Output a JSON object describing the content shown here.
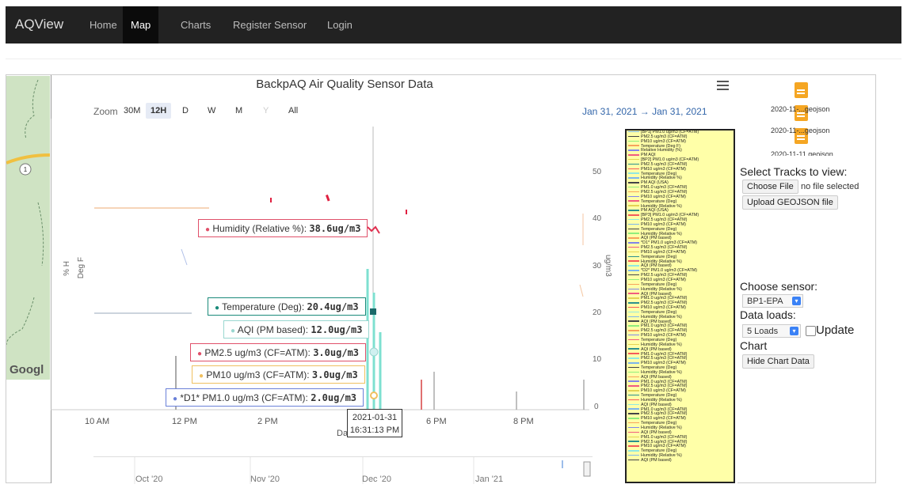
{
  "nav": {
    "brand": "AQView",
    "items": [
      {
        "label": "Home",
        "active": false
      },
      {
        "label": "Map",
        "active": true
      },
      {
        "label": "Charts",
        "active": false
      },
      {
        "label": "Register Sensor",
        "active": false
      },
      {
        "label": "Login",
        "active": false
      }
    ]
  },
  "map": {
    "route_number": "1",
    "attribution": "Googl"
  },
  "chart": {
    "title": "BackpAQ Air Quality Sensor Data",
    "zoom_label": "Zoom",
    "zoom_buttons": [
      "30M",
      "12H",
      "D",
      "W",
      "M",
      "Y",
      "All"
    ],
    "zoom_active": "12H",
    "zoom_disabled": "Y",
    "date_from": "Jan 31, 2021",
    "date_arrow": "→",
    "date_to": "Jan 31, 2021",
    "y_left_label_1": "% H",
    "y_left_label_2": "Deg F",
    "y_right_label": "ug/m3",
    "y_right_ticks": [
      "50",
      "40",
      "30",
      "20",
      "10",
      "0"
    ],
    "x_ticks": [
      "10 AM",
      "12 PM",
      "2 PM",
      "4 PM",
      "6 PM",
      "8 PM"
    ],
    "x_axis_label": "Da",
    "hover_date": "2021-01-31",
    "hover_time": "16:31:13 PM",
    "navigator_ticks": [
      "Oct '20",
      "Nov '20",
      "Dec '20",
      "Jan '21"
    ],
    "tooltips": [
      {
        "label": "Humidity (Relative %): ",
        "value": "38.6ug/m3",
        "color": "#e0506a"
      },
      {
        "label": "Temperature (Deg): ",
        "value": "20.4ug/m3",
        "color": "#1a8a7a"
      },
      {
        "label": "AQI (PM based): ",
        "value": "12.0ug/m3",
        "color": "#9ad7d0"
      },
      {
        "label": "PM2.5 ug/m3 (CF=ATM): ",
        "value": "3.0ug/m3",
        "color": "#e0506a"
      },
      {
        "label": "PM10 ug/m3 (CF=ATM): ",
        "value": "3.0ug/m3",
        "color": "#f0c060"
      },
      {
        "label": "*D1* PM1.0 ug/m3 (CF=ATM): ",
        "value": "2.0ug/m3",
        "color": "#6a80d8"
      }
    ]
  },
  "legend": {
    "items": [
      {
        "label": "[BP1] PM1.0 ug/m3 (CF=ATM)",
        "color": "#7cb5ec"
      },
      {
        "label": "PM2.5 ug/m3 (CF=ATM)",
        "color": "#434348"
      },
      {
        "label": "PM10 ug/m3 (CF=ATM)",
        "color": "#90ed7d"
      },
      {
        "label": "Temperature (Deg F)",
        "color": "#f7a35c"
      },
      {
        "label": "Relative Humidity (%)",
        "color": "#8085e9"
      },
      {
        "label": "PM AQI",
        "color": "#f15c80"
      },
      {
        "label": "[BP2] PM1.0 ug/m3 (CF=ATM)",
        "color": "#e4d354"
      },
      {
        "label": "PM2.5 ug/m3 (CF=ATM)",
        "color": "#2b908f"
      },
      {
        "label": "PM10 ug/m3 (CF=ATM)",
        "color": "#f45b5b"
      },
      {
        "label": "Temperature (Deg)",
        "color": "#91e8e1"
      },
      {
        "label": "Humidity (Relative %)",
        "color": "#7cb5ec"
      },
      {
        "label": "PM AQI (USA)",
        "color": "#434348"
      },
      {
        "label": "PM1.0 ug/m3 (CF=ATM)",
        "color": "#90ed7d"
      },
      {
        "label": "PM2.5 ug/m3 (CF=ATM)",
        "color": "#f7a35c"
      },
      {
        "label": "PM10 ug/m3 (CF=ATM)",
        "color": "#8085e9"
      },
      {
        "label": "Temperature (Deg)",
        "color": "#f15c80"
      },
      {
        "label": "Humidity (Relative %)",
        "color": "#e4d354"
      },
      {
        "label": "PM AQI (USA)",
        "color": "#2b908f"
      },
      {
        "label": "[BP3] PM1.0 ug/m3 (CF=ATM)",
        "color": "#f45b5b"
      },
      {
        "label": "PM2.5 ug/m3 (CF=ATM)",
        "color": "#91e8e1"
      },
      {
        "label": "PM10 ug/m3 (CF=ATM)",
        "color": "#7cb5ec"
      },
      {
        "label": "Temperature (Deg)",
        "color": "#434348"
      },
      {
        "label": "Humidity (Relative %)",
        "color": "#90ed7d"
      },
      {
        "label": "AQI (PM based)",
        "color": "#f7a35c"
      },
      {
        "label": "*D1* PM1.0 ug/m3 (CF=ATM)",
        "color": "#8085e9"
      },
      {
        "label": "PM2.5 ug/m3 (CF=ATM)",
        "color": "#f15c80"
      },
      {
        "label": "PM10 ug/m3 (CF=ATM)",
        "color": "#e4d354"
      },
      {
        "label": "Temperature (Deg)",
        "color": "#2b908f"
      },
      {
        "label": "Humidity (Relative %)",
        "color": "#f45b5b"
      },
      {
        "label": "AQI (PM based)",
        "color": "#91e8e1"
      },
      {
        "label": "*D2* PM1.0 ug/m3 (CF=ATM)",
        "color": "#7cb5ec"
      },
      {
        "label": "PM2.5 ug/m3 (CF=ATM)",
        "color": "#434348"
      },
      {
        "label": "PM10 ug/m3 (CF=ATM)",
        "color": "#90ed7d"
      },
      {
        "label": "Temperature (Deg)",
        "color": "#f7a35c"
      },
      {
        "label": "Humidity (Relative %)",
        "color": "#8085e9"
      },
      {
        "label": "AQI (PM based)",
        "color": "#f15c80"
      },
      {
        "label": "PM1.0 ug/m3 (CF=ATM)",
        "color": "#e4d354"
      },
      {
        "label": "PM2.5 ug/m3 (CF=ATM)",
        "color": "#2b908f"
      },
      {
        "label": "PM10 ug/m3 (CF=ATM)",
        "color": "#f45b5b"
      },
      {
        "label": "Temperature (Deg)",
        "color": "#91e8e1"
      },
      {
        "label": "Humidity (Relative %)",
        "color": "#7cb5ec"
      },
      {
        "label": "AQI (PM based)",
        "color": "#434348"
      },
      {
        "label": "PM1.0 ug/m3 (CF=ATM)",
        "color": "#90ed7d"
      },
      {
        "label": "PM2.5 ug/m3 (CF=ATM)",
        "color": "#f7a35c"
      },
      {
        "label": "PM10 ug/m3 (CF=ATM)",
        "color": "#8085e9"
      },
      {
        "label": "Temperature (Deg)",
        "color": "#f15c80"
      },
      {
        "label": "Humidity (Relative %)",
        "color": "#e4d354"
      },
      {
        "label": "AQI (PM based)",
        "color": "#2b908f"
      },
      {
        "label": "PM1.0 ug/m3 (CF=ATM)",
        "color": "#f45b5b"
      },
      {
        "label": "PM2.5 ug/m3 (CF=ATM)",
        "color": "#91e8e1"
      },
      {
        "label": "PM10 ug/m3 (CF=ATM)",
        "color": "#7cb5ec"
      },
      {
        "label": "Temperature (Deg)",
        "color": "#434348"
      },
      {
        "label": "Humidity (Relative %)",
        "color": "#90ed7d"
      },
      {
        "label": "AQI (PM based)",
        "color": "#f7a35c"
      },
      {
        "label": "PM1.0 ug/m3 (CF=ATM)",
        "color": "#8085e9"
      },
      {
        "label": "PM2.5 ug/m3 (CF=ATM)",
        "color": "#f15c80"
      },
      {
        "label": "PM10 ug/m3 (CF=ATM)",
        "color": "#e4d354"
      },
      {
        "label": "Temperature (Deg)",
        "color": "#2b908f"
      },
      {
        "label": "Humidity (Relative %)",
        "color": "#f45b5b"
      },
      {
        "label": "AQI (PM based)",
        "color": "#91e8e1"
      },
      {
        "label": "PM1.0 ug/m3 (CF=ATM)",
        "color": "#7cb5ec"
      },
      {
        "label": "PM2.5 ug/m3 (CF=ATM)",
        "color": "#434348"
      },
      {
        "label": "PM10 ug/m3 (CF=ATM)",
        "color": "#90ed7d"
      },
      {
        "label": "Temperature (Deg)",
        "color": "#f7a35c"
      },
      {
        "label": "Humidity (Relative %)",
        "color": "#8085e9"
      },
      {
        "label": "AQI (PM based)",
        "color": "#f15c80"
      },
      {
        "label": "PM1.0 ug/m3 (CF=ATM)",
        "color": "#e4d354"
      },
      {
        "label": "PM2.5 ug/m3 (CF=ATM)",
        "color": "#2b908f"
      },
      {
        "label": "PM10 ug/m3 (CF=ATM)",
        "color": "#f45b5b"
      },
      {
        "label": "Temperature (Deg)",
        "color": "#91e8e1"
      },
      {
        "label": "Humidity (Relative %)",
        "color": "#7cb5ec"
      },
      {
        "label": "AQI (PM based)",
        "color": "#434348"
      }
    ]
  },
  "panel": {
    "files": [
      "2020-11-...geojson",
      "2020-11-...geojson",
      "2020-11-11.geojson"
    ],
    "select_tracks": "Select Tracks to view:",
    "choose_file": "Choose File",
    "no_file": "no file selected",
    "upload": "Upload GEOJSON file",
    "choose_sensor": "Choose sensor:",
    "sensor_value": "BP1-EPA",
    "data_loads": "Data loads:",
    "loads_value": "5 Loads",
    "update": "Update",
    "chart_word": "Chart",
    "hide_chart": "Hide Chart Data"
  }
}
